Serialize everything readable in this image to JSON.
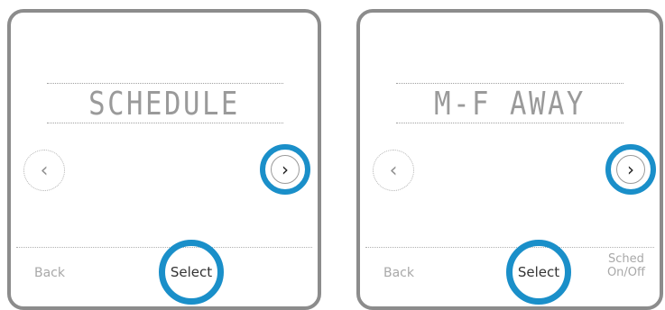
{
  "colors": {
    "accent": "#1a8fc9",
    "lcd_text": "#9a9a9a",
    "frame": "#8c8c8c"
  },
  "screens": [
    {
      "title": "SCHEDULE",
      "prev_icon": "chevron-left-icon",
      "next_icon": "chevron-right-icon",
      "prev_glyph": "‹",
      "next_glyph": "›",
      "back_label": "Back",
      "select_label": "Select"
    },
    {
      "title": "M-F AWAY",
      "prev_icon": "chevron-left-icon",
      "next_icon": "chevron-right-icon",
      "prev_glyph": "‹",
      "next_glyph": "›",
      "back_label": "Back",
      "select_label": "Select",
      "sched_label_line1": "Sched",
      "sched_label_line2": "On/Off"
    }
  ]
}
